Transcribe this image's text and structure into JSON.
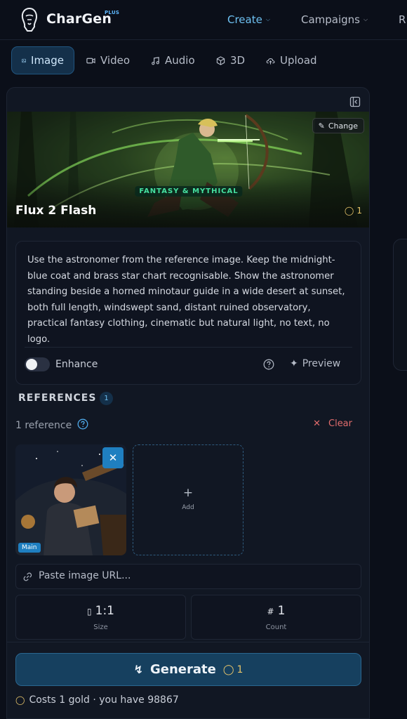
{
  "brand": {
    "name": "CharGen",
    "tier": "PLUS"
  },
  "nav": {
    "items": [
      {
        "label": "Create"
      },
      {
        "label": "Campaigns"
      },
      {
        "label": "R"
      }
    ]
  },
  "modes": [
    {
      "label": "Image",
      "icon": "image-icon"
    },
    {
      "label": "Video",
      "icon": "video-icon"
    },
    {
      "label": "Audio",
      "icon": "music-icon"
    },
    {
      "label": "3D",
      "icon": "cube-icon"
    },
    {
      "label": "Upload",
      "icon": "upload-icon"
    }
  ],
  "model": {
    "name": "Flux 2 Flash",
    "genre": "FANTASY & MYTHICAL",
    "change_label": "Change",
    "cost": "1"
  },
  "prompt": {
    "text": "Use the astronomer from the reference image. Keep the midnight-blue coat and brass star chart recognisable. Show the astronomer standing beside a horned minotaur guide in a wide desert at sunset, both full length, windswept sand, distant ruined observatory, practical fantasy clothing, cinematic but natural light, no text, no logo.",
    "enhance_label": "Enhance",
    "enhance_on": false,
    "preview_label": "Preview"
  },
  "references": {
    "title": "REFERENCES",
    "badge": "1",
    "count_label": "1 reference",
    "clear_label": "Clear",
    "main_tag": "Main",
    "add_label": "Add",
    "url_placeholder": "Paste image URL..."
  },
  "options": {
    "size": {
      "value": "1:1",
      "label": "Size"
    },
    "count": {
      "value": "1",
      "label": "Count"
    }
  },
  "generate": {
    "label": "Generate",
    "cost": "1",
    "cost_line": "Costs 1 gold · you have 98867"
  },
  "colors": {
    "accent": "#6ec1f2",
    "gold": "#e8c56a",
    "danger": "#e06c6c",
    "background": "#0b0f19"
  }
}
